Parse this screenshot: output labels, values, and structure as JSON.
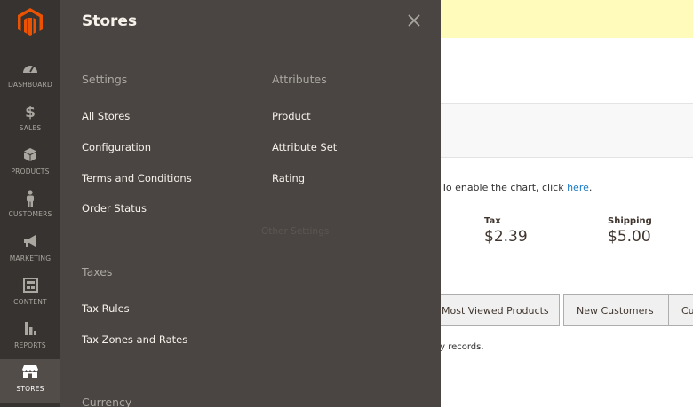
{
  "leftnav": {
    "items": [
      {
        "label": "DASHBOARD",
        "icon": "speedometer-icon"
      },
      {
        "label": "SALES",
        "icon": "dollar-icon",
        "glyph": "$"
      },
      {
        "label": "PRODUCTS",
        "icon": "box-icon"
      },
      {
        "label": "CUSTOMERS",
        "icon": "person-icon"
      },
      {
        "label": "MARKETING",
        "icon": "megaphone-icon"
      },
      {
        "label": "CONTENT",
        "icon": "layout-icon"
      },
      {
        "label": "REPORTS",
        "icon": "bar-chart-icon"
      },
      {
        "label": "STORES",
        "icon": "storefront-icon"
      }
    ],
    "active": "STORES"
  },
  "flyout": {
    "title": "Stores",
    "settings": {
      "heading": "Settings",
      "links": [
        "All Stores",
        "Configuration",
        "Terms and Conditions",
        "Order Status"
      ]
    },
    "attributes": {
      "heading": "Attributes",
      "links": [
        "Product",
        "Attribute Set",
        "Rating"
      ]
    },
    "other_settings": "Other Settings",
    "taxes": {
      "heading": "Taxes",
      "links": [
        "Tax Rules",
        "Tax Zones and Rates"
      ]
    },
    "currency": {
      "heading": "Currency"
    }
  },
  "background": {
    "chart_msg_prefix": "To enable the chart, click ",
    "chart_msg_link": "here",
    "chart_msg_suffix": ".",
    "tax_label": "Tax",
    "tax_value": "$2.39",
    "shipping_label": "Shipping",
    "shipping_value": "$5.00",
    "tabs": [
      "Most Viewed Products",
      "New Customers",
      "Cu"
    ],
    "records_text": "ry records."
  },
  "colors": {
    "nav_bg": "#373330",
    "flyout_bg": "#4a4542",
    "logo_orange": "#eb5202",
    "banner_yellow": "#fffbbb"
  }
}
